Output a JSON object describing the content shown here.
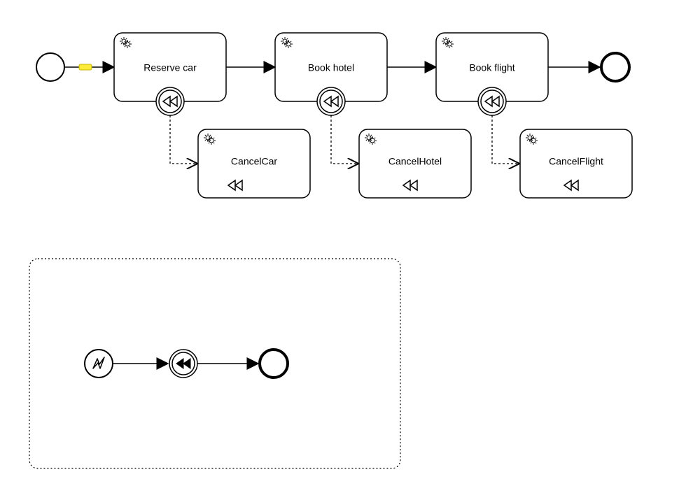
{
  "tasks": {
    "reserve_car": {
      "label": "Reserve car"
    },
    "book_hotel": {
      "label": "Book hotel"
    },
    "book_flight": {
      "label": "Book flight"
    },
    "cancel_car": {
      "label": "CancelCar"
    },
    "cancel_hotel": {
      "label": "CancelHotel"
    },
    "cancel_flight": {
      "label": "CancelFlight"
    }
  },
  "process": {
    "main": {
      "start_event": "none-start",
      "end_event": "none-end",
      "compensation_boundary_on": [
        "reserve_car",
        "book_hotel",
        "book_flight"
      ],
      "compensation_handlers": {
        "reserve_car": "cancel_car",
        "book_hotel": "cancel_hotel",
        "book_flight": "cancel_flight"
      }
    },
    "event_subprocess": {
      "start": "error-start-event",
      "throw": "compensation-intermediate-throw",
      "end": "none-end"
    }
  }
}
